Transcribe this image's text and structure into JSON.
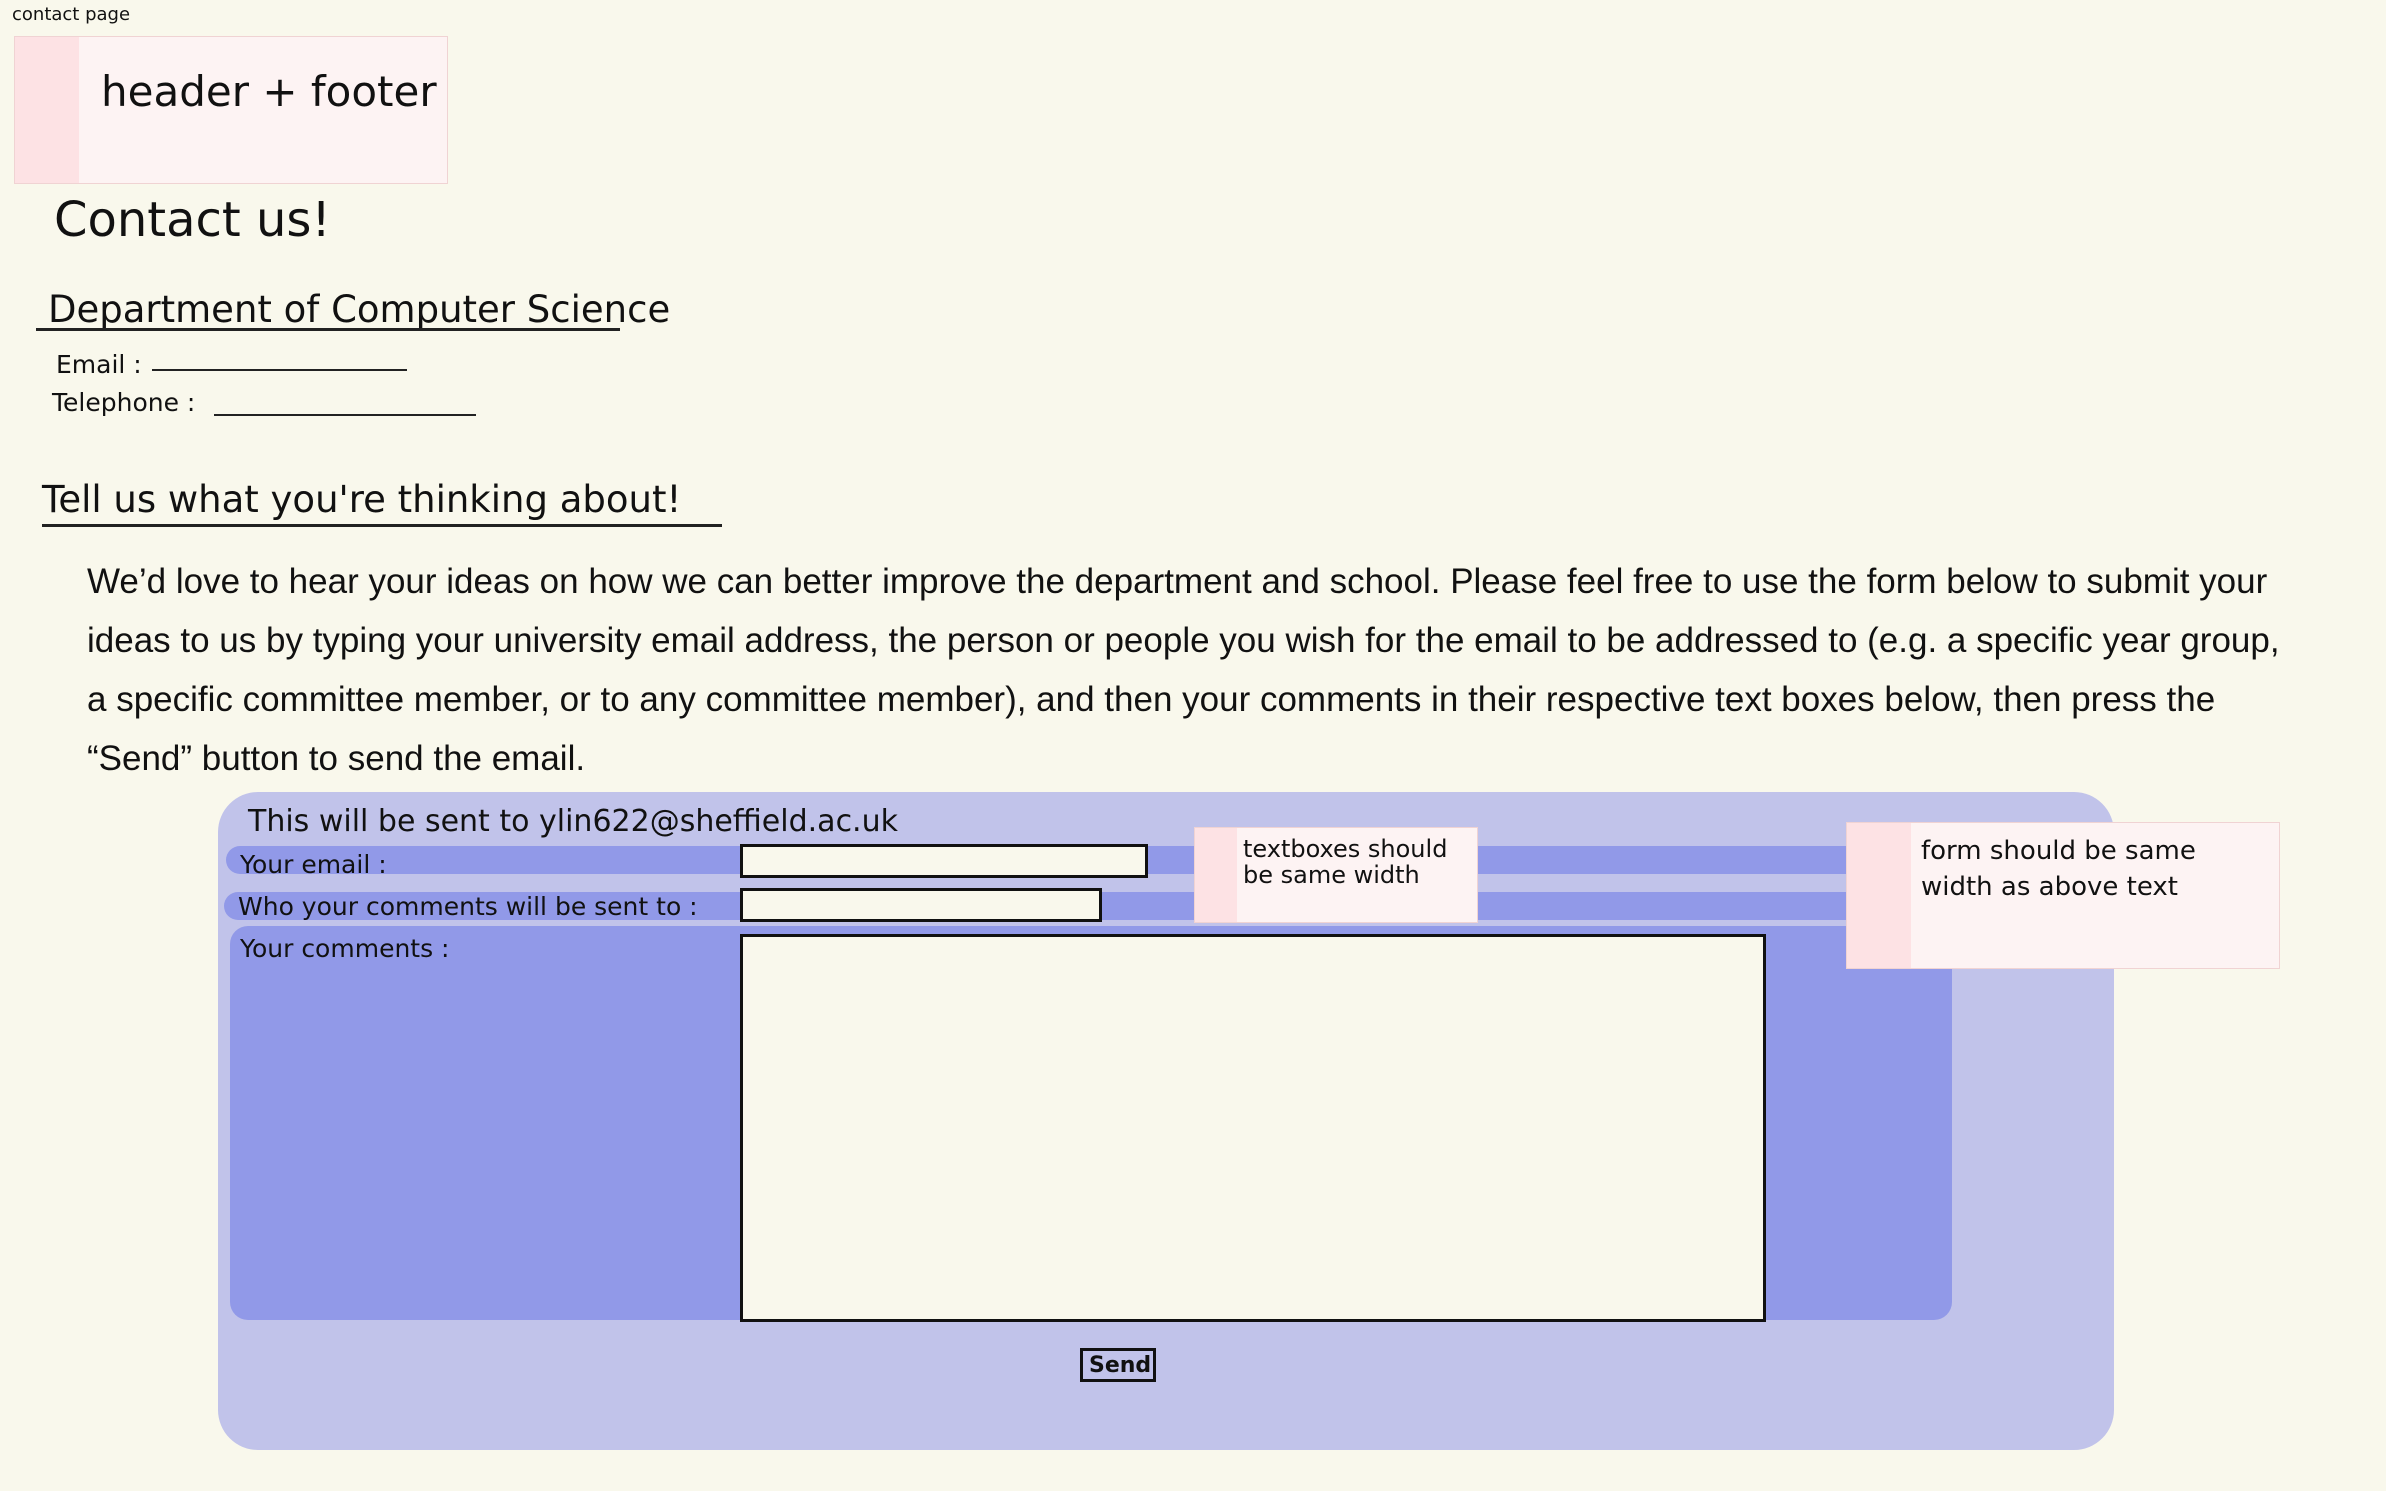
{
  "page_caption": "contact page",
  "header_footer_note": "header + footer",
  "page_title": "Contact us!",
  "department": {
    "heading": "Department of Computer Science",
    "email_label": "Email :",
    "telephone_label": "Telephone :"
  },
  "feedback_heading": "Tell us what you're thinking about!",
  "intro_paragraph": "We’d love to hear your ideas on how we can better improve the department and school. Please feel free to use the form below to submit your ideas to us by typing your university email address, the person or people you wish for the email to be addressed to (e.g. a specific year group, a specific committee member, or to any committee member), and then your comments in their respective text boxes below, then press the “Send” button to send the email.",
  "form": {
    "send_to_text": "This will be sent to ylin622@sheffield.ac.uk",
    "email_label": "Your email :",
    "recipient_label": "Who your comments will be sent to :",
    "comments_label": "Your comments :",
    "send_label": "Send"
  },
  "annotations": {
    "textbox_width_note": "textboxes should be same width",
    "form_width_note": "form should be same width as above text"
  },
  "colors": {
    "background": "#f9f8ec",
    "form_outer": "#c1c3ea",
    "form_inner": "#9199e8",
    "note_bg": "#fdf3f3",
    "note_strip": "#fde2e4"
  }
}
